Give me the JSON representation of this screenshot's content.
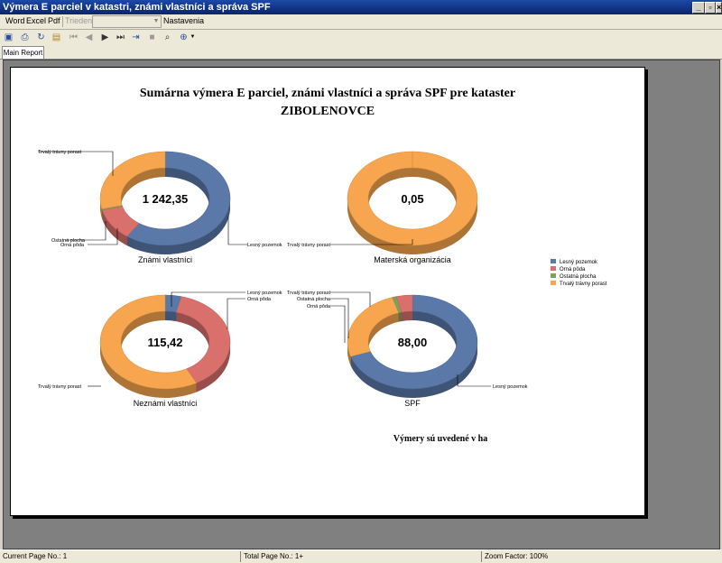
{
  "window": {
    "title": "Výmera E parciel v katastri, známi vlastníci a správa SPF"
  },
  "menu": {
    "word": "Word",
    "excel": "Excel",
    "pdf": "Pdf",
    "sort": "Triedenie",
    "settings": "Nastavenia"
  },
  "tabs": [
    "Main Report"
  ],
  "report": {
    "title": "Sumárna výmera E parciel, známi vlastníci a správa SPF pre kataster",
    "subtitle": "ZIBOLENOVCE",
    "footnote": "Výmery sú uvedené v ha",
    "legend": [
      "Lesný pozemok",
      "Orná pôda",
      "Ostatná plocha",
      "Trvalý trávny porast"
    ],
    "colors": {
      "forest": "#5a78a8",
      "arable": "#d9706b",
      "other": "#7ca35a",
      "grass": "#f7a64f"
    }
  },
  "chart_data": [
    {
      "type": "pie",
      "title": "Známi vlastníci",
      "total_label": "1 242,35",
      "categories": [
        "Lesný pozemok",
        "Orná pôda",
        "Ostatná plocha",
        "Trvalý trávny porast"
      ],
      "values": [
        0.6,
        0.11,
        0.004,
        0.286
      ]
    },
    {
      "type": "pie",
      "title": "Materská organizácia",
      "total_label": "0,05",
      "categories": [
        "Lesný pozemok",
        "Trvalý trávny porast"
      ],
      "values": [
        0.0,
        1.0
      ]
    },
    {
      "type": "pie",
      "title": "Neznámi vlastníci",
      "total_label": "115,42",
      "categories": [
        "Lesný pozemok",
        "Orná pôda",
        "Trvalý trávny porast"
      ],
      "values": [
        0.04,
        0.38,
        0.58
      ]
    },
    {
      "type": "pie",
      "title": "SPF",
      "total_label": "88,00",
      "categories": [
        "Lesný pozemok",
        "Trvalý trávny porast",
        "Ostatná plocha",
        "Orná pôda"
      ],
      "values": [
        0.7,
        0.25,
        0.01,
        0.04
      ]
    }
  ],
  "status": {
    "current_page": "Current Page No.: 1",
    "total_page": "Total Page No.: 1+",
    "zoom": "Zoom Factor: 100%"
  }
}
